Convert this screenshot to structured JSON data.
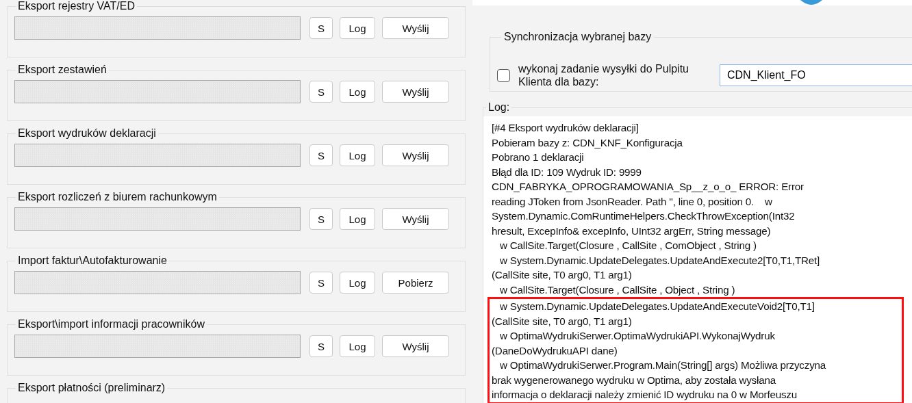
{
  "export_groups": [
    {
      "title": "Eksport rejestry VAT/ED",
      "buttons": [
        "S",
        "Log",
        "Wyślij"
      ]
    },
    {
      "title": "Eksport zestawień",
      "buttons": [
        "S",
        "Log",
        "Wyślij"
      ]
    },
    {
      "title": "Eksport wydruków deklaracji",
      "buttons": [
        "S",
        "Log",
        "Wyślij"
      ]
    },
    {
      "title": "Eksport rozliczeń z biurem rachunkowym",
      "buttons": [
        "S",
        "Log",
        "Wyślij"
      ]
    },
    {
      "title": "Import faktur\\Autofakturowanie",
      "buttons": [
        "S",
        "Log",
        "Pobierz"
      ]
    },
    {
      "title": "Eksport\\import informacji pracowników",
      "buttons": [
        "S",
        "Log",
        "Wyślij"
      ]
    },
    {
      "title": "Eksport płatności (preliminarz)"
    }
  ],
  "sync": {
    "title": "Synchronizacja wybranej bazy",
    "checkbox": {
      "label": "wykonaj zadanie wysyłki do Pulpitu Klienta dla bazy:",
      "checked": false
    },
    "database": "CDN_Klient_FO"
  },
  "log": {
    "title": "Log:",
    "lines": [
      {
        "text": "[#4 Eksport wydruków deklaracji]",
        "highlighted": false
      },
      {
        "text": "Pobieram bazy z: CDN_KNF_Konfiguracja",
        "highlighted": false
      },
      {
        "text": "Pobrano 1 deklaracji",
        "highlighted": false
      },
      {
        "text": "Błąd dla ID: 109 Wydruk ID: 9999",
        "highlighted": false
      },
      {
        "text": "CDN_FABRYKA_OPROGRAMOWANIA_Sp__z_o_o_ ERROR: Error",
        "highlighted": false
      },
      {
        "text": "reading JToken from JsonReader. Path '', line 0, position 0.    w",
        "highlighted": false
      },
      {
        "text": "System.Dynamic.ComRuntimeHelpers.CheckThrowException(Int32",
        "highlighted": false
      },
      {
        "text": "hresult, ExcepInfo& excepInfo, UInt32 argErr, String message)",
        "highlighted": false
      },
      {
        "text": "   w CallSite.Target(Closure , CallSite , ComObject , String )",
        "highlighted": false
      },
      {
        "text": "   w System.Dynamic.UpdateDelegates.UpdateAndExecute2[T0,T1,TRet]",
        "highlighted": false
      },
      {
        "text": "(CallSite site, T0 arg0, T1 arg1)",
        "highlighted": false
      },
      {
        "text": "   w CallSite.Target(Closure , CallSite , Object , String )",
        "highlighted": false
      },
      {
        "text": "   w System.Dynamic.UpdateDelegates.UpdateAndExecuteVoid2[T0,T1]",
        "highlighted": true
      },
      {
        "text": "(CallSite site, T0 arg0, T1 arg1)",
        "highlighted": true
      },
      {
        "text": "   w OptimaWydrukiSerwer.OptimaWydrukiAPI.WykonajWydruk",
        "highlighted": true
      },
      {
        "text": "(DaneDoWydrukuAPI dane)",
        "highlighted": true
      },
      {
        "text": "   w OptimaWydrukiSerwer.Program.Main(String[] args) Możliwa przyczyna",
        "highlighted": true
      },
      {
        "text": "brak wygenerowanego wydruku w Optima, aby została wysłana",
        "highlighted": true
      },
      {
        "text": "informacja o deklaracji należy zmienić ID wydruku na 0 w Morfeuszu",
        "highlighted": true
      }
    ]
  }
}
